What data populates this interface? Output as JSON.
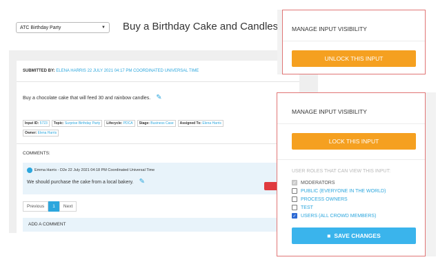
{
  "header": {
    "event_select": "ATC Birthday Party",
    "title": "Buy a Birthday Cake and Candles"
  },
  "input": {
    "submitted_label": "SUBMITTED BY:",
    "submitted_value": "ELENA HARRIS 22 JULY 2021 04:17 PM COORDINATED UNIVERSAL TIME",
    "description": "Buy a chocolate cake that will feed 30 and rainbow candles.",
    "tags": [
      {
        "label": "Input ID:",
        "value": "5723"
      },
      {
        "label": "Topic:",
        "value": "Surprise Birthday Party"
      },
      {
        "label": "Lifecycle:",
        "value": "PDCA"
      },
      {
        "label": "Stage:",
        "value": "Business Case"
      },
      {
        "label": "Assigned To:",
        "value": "Elena Harris"
      }
    ],
    "owner": {
      "label": "Owner:",
      "value": "Elena Harris"
    }
  },
  "comments": {
    "label": "COMMENTS:",
    "items": [
      {
        "author_meta": "Emma Harris - D2e 22 July 2021 04:18 PM Coordinated Universal Time",
        "body": "We should purchase the cake from a local bakery."
      }
    ],
    "pager": {
      "prev": "Previous",
      "page": "1",
      "next": "Next"
    },
    "add_comment": "ADD A COMMENT"
  },
  "visibility_top": {
    "title": "MANAGE INPUT VISIBILITY",
    "button": "UNLOCK THIS INPUT"
  },
  "visibility_bottom": {
    "title": "MANAGE INPUT VISIBILITY",
    "button": "LOCK THIS INPUT",
    "roles_heading": "USER ROLES THAT CAN VIEW THIS INPUT:",
    "roles": [
      {
        "label": "MODERATORS",
        "state": "checked-disabled"
      },
      {
        "label": "PUBLIC (EVERYONE IN THE WORLD)",
        "state": "unchecked"
      },
      {
        "label": "PROCESS OWNERS",
        "state": "unchecked"
      },
      {
        "label": "TEST",
        "state": "unchecked"
      },
      {
        "label": "USERS (ALL CROWD MEMBERS)",
        "state": "checked"
      }
    ],
    "save_button": "SAVE CHANGES"
  },
  "colors": {
    "accent_blue": "#2ba6dd",
    "orange_button": "#f5a020",
    "save_button": "#3ab4ec",
    "panel_border": "#e07474",
    "delete_red": "#e03a3e"
  }
}
